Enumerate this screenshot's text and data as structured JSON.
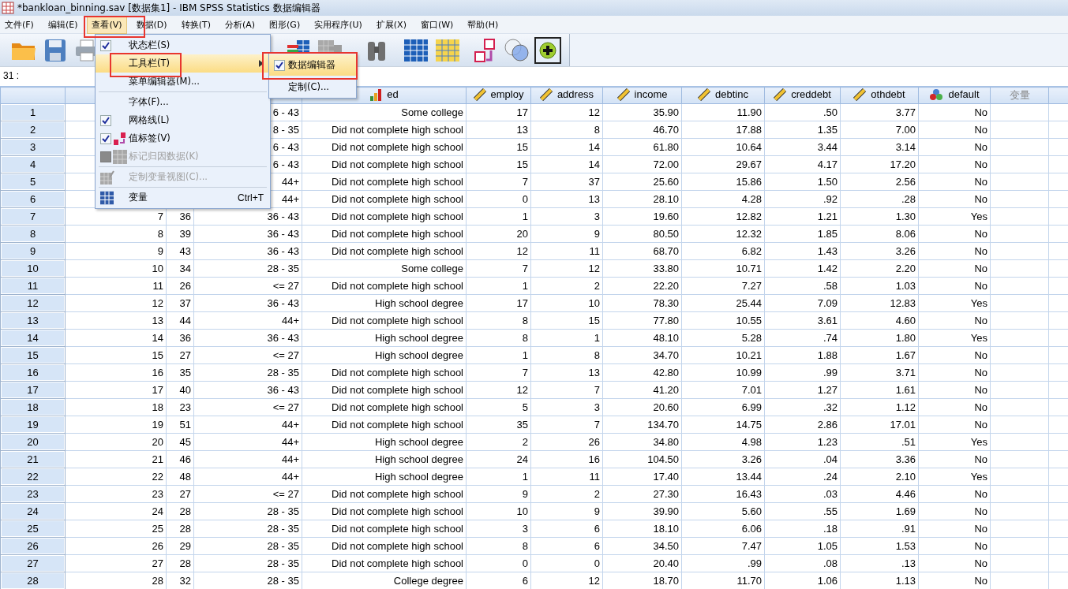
{
  "window": {
    "title": "*bankloan_binning.sav [数据集1] - IBM SPSS Statistics 数据编辑器"
  },
  "menu_bar": [
    {
      "label": "文件(F)",
      "selected": false
    },
    {
      "label": "编辑(E)",
      "selected": false
    },
    {
      "label": "查看(V)",
      "selected": true
    },
    {
      "label": "数据(D)",
      "selected": false
    },
    {
      "label": "转换(T)",
      "selected": false
    },
    {
      "label": "分析(A)",
      "selected": false
    },
    {
      "label": "图形(G)",
      "selected": false
    },
    {
      "label": "实用程序(U)",
      "selected": false
    },
    {
      "label": "扩展(X)",
      "selected": false
    },
    {
      "label": "窗口(W)",
      "selected": false
    },
    {
      "label": "帮助(H)",
      "selected": false
    }
  ],
  "view_menu": [
    {
      "kind": "check",
      "label": "状态栏(S)",
      "checked": true,
      "disabled": false,
      "highlighted": false
    },
    {
      "kind": "submenu",
      "label": "工具栏(T)",
      "disabled": false,
      "highlighted": true
    },
    {
      "kind": "plain",
      "label": "菜单编辑器(M)...",
      "disabled": false,
      "highlighted": false
    },
    {
      "kind": "separator"
    },
    {
      "kind": "plain",
      "label": "字体(F)...",
      "disabled": false,
      "highlighted": false
    },
    {
      "kind": "check",
      "label": "网格线(L)",
      "checked": true,
      "disabled": false,
      "highlighted": false
    },
    {
      "kind": "labels",
      "label": "值标签(V)",
      "checked": true,
      "disabled": false,
      "highlighted": false
    },
    {
      "kind": "impute",
      "label": "标记归因数据(K)",
      "disabled": true,
      "highlighted": false
    },
    {
      "kind": "separator"
    },
    {
      "kind": "view",
      "label": "定制变量视图(C)...",
      "disabled": true,
      "highlighted": false
    },
    {
      "kind": "separator"
    },
    {
      "kind": "variables",
      "label": "变量",
      "shortcut": "Ctrl+T",
      "disabled": false,
      "highlighted": false
    }
  ],
  "toolbar_submenu": [
    {
      "kind": "check",
      "label": "数据编辑器",
      "checked": true,
      "highlighted": true
    },
    {
      "kind": "plain",
      "label": "定制(C)...",
      "highlighted": false
    }
  ],
  "cell_editor": {
    "label": "31 :"
  },
  "table": {
    "columns": [
      {
        "kind": "hidden"
      },
      {
        "kind": "hidden"
      },
      {
        "kind": "hidden"
      },
      {
        "kind": "ordinal",
        "label": "ed"
      },
      {
        "kind": "scale",
        "label": "employ"
      },
      {
        "kind": "scale",
        "label": "address"
      },
      {
        "kind": "scale",
        "label": "income"
      },
      {
        "kind": "scale",
        "label": "debtinc"
      },
      {
        "kind": "scale",
        "label": "creddebt"
      },
      {
        "kind": "scale",
        "label": "othdebt"
      },
      {
        "kind": "nominal",
        "label": "default"
      },
      {
        "kind": "empty",
        "label": "变量"
      },
      {
        "kind": "hidden"
      }
    ],
    "rows": [
      {
        "number": "1",
        "cells": [
          null,
          null,
          "6 - 43",
          "Some college",
          "17",
          "12",
          "35.90",
          "11.90",
          ".50",
          "3.77",
          "No"
        ]
      },
      {
        "number": "2",
        "cells": [
          null,
          null,
          "8 - 35",
          "Did not complete high school",
          "13",
          "8",
          "46.70",
          "17.88",
          "1.35",
          "7.00",
          "No"
        ]
      },
      {
        "number": "3",
        "cells": [
          null,
          null,
          "6 - 43",
          "Did not complete high school",
          "15",
          "14",
          "61.80",
          "10.64",
          "3.44",
          "3.14",
          "No"
        ]
      },
      {
        "number": "4",
        "cells": [
          null,
          null,
          "6 - 43",
          "Did not complete high school",
          "15",
          "14",
          "72.00",
          "29.67",
          "4.17",
          "17.20",
          "No"
        ]
      },
      {
        "number": "5",
        "cells": [
          null,
          null,
          "44+",
          "Did not complete high school",
          "7",
          "37",
          "25.60",
          "15.86",
          "1.50",
          "2.56",
          "No"
        ]
      },
      {
        "number": "6",
        "cells": [
          null,
          null,
          "44+",
          "Did not complete high school",
          "0",
          "13",
          "28.10",
          "4.28",
          ".92",
          ".28",
          "No"
        ]
      },
      {
        "number": "7",
        "cells": [
          "7",
          "36",
          "36 - 43",
          "Did not complete high school",
          "1",
          "3",
          "19.60",
          "12.82",
          "1.21",
          "1.30",
          "Yes"
        ]
      },
      {
        "number": "8",
        "cells": [
          "8",
          "39",
          "36 - 43",
          "Did not complete high school",
          "20",
          "9",
          "80.50",
          "12.32",
          "1.85",
          "8.06",
          "No"
        ]
      },
      {
        "number": "9",
        "cells": [
          "9",
          "43",
          "36 - 43",
          "Did not complete high school",
          "12",
          "11",
          "68.70",
          "6.82",
          "1.43",
          "3.26",
          "No"
        ]
      },
      {
        "number": "10",
        "cells": [
          "10",
          "34",
          "28 - 35",
          "Some college",
          "7",
          "12",
          "33.80",
          "10.71",
          "1.42",
          "2.20",
          "No"
        ]
      },
      {
        "number": "11",
        "cells": [
          "11",
          "26",
          "<= 27",
          "Did not complete high school",
          "1",
          "2",
          "22.20",
          "7.27",
          ".58",
          "1.03",
          "No"
        ]
      },
      {
        "number": "12",
        "cells": [
          "12",
          "37",
          "36 - 43",
          "High school degree",
          "17",
          "10",
          "78.30",
          "25.44",
          "7.09",
          "12.83",
          "Yes"
        ]
      },
      {
        "number": "13",
        "cells": [
          "13",
          "44",
          "44+",
          "Did not complete high school",
          "8",
          "15",
          "77.80",
          "10.55",
          "3.61",
          "4.60",
          "No"
        ]
      },
      {
        "number": "14",
        "cells": [
          "14",
          "36",
          "36 - 43",
          "High school degree",
          "8",
          "1",
          "48.10",
          "5.28",
          ".74",
          "1.80",
          "Yes"
        ]
      },
      {
        "number": "15",
        "cells": [
          "15",
          "27",
          "<= 27",
          "High school degree",
          "1",
          "8",
          "34.70",
          "10.21",
          "1.88",
          "1.67",
          "No"
        ]
      },
      {
        "number": "16",
        "cells": [
          "16",
          "35",
          "28 - 35",
          "Did not complete high school",
          "7",
          "13",
          "42.80",
          "10.99",
          ".99",
          "3.71",
          "No"
        ]
      },
      {
        "number": "17",
        "cells": [
          "17",
          "40",
          "36 - 43",
          "Did not complete high school",
          "12",
          "7",
          "41.20",
          "7.01",
          "1.27",
          "1.61",
          "No"
        ]
      },
      {
        "number": "18",
        "cells": [
          "18",
          "23",
          "<= 27",
          "Did not complete high school",
          "5",
          "3",
          "20.60",
          "6.99",
          ".32",
          "1.12",
          "No"
        ]
      },
      {
        "number": "19",
        "cells": [
          "19",
          "51",
          "44+",
          "Did not complete high school",
          "35",
          "7",
          "134.70",
          "14.75",
          "2.86",
          "17.01",
          "No"
        ]
      },
      {
        "number": "20",
        "cells": [
          "20",
          "45",
          "44+",
          "High school degree",
          "2",
          "26",
          "34.80",
          "4.98",
          "1.23",
          ".51",
          "Yes"
        ]
      },
      {
        "number": "21",
        "cells": [
          "21",
          "46",
          "44+",
          "High school degree",
          "24",
          "16",
          "104.50",
          "3.26",
          ".04",
          "3.36",
          "No"
        ]
      },
      {
        "number": "22",
        "cells": [
          "22",
          "48",
          "44+",
          "High school degree",
          "1",
          "11",
          "17.40",
          "13.44",
          ".24",
          "2.10",
          "Yes"
        ]
      },
      {
        "number": "23",
        "cells": [
          "23",
          "27",
          "<= 27",
          "Did not complete high school",
          "9",
          "2",
          "27.30",
          "16.43",
          ".03",
          "4.46",
          "No"
        ]
      },
      {
        "number": "24",
        "cells": [
          "24",
          "28",
          "28 - 35",
          "Did not complete high school",
          "10",
          "9",
          "39.90",
          "5.60",
          ".55",
          "1.69",
          "No"
        ]
      },
      {
        "number": "25",
        "cells": [
          "25",
          "28",
          "28 - 35",
          "Did not complete high school",
          "3",
          "6",
          "18.10",
          "6.06",
          ".18",
          ".91",
          "No"
        ]
      },
      {
        "number": "26",
        "cells": [
          "26",
          "29",
          "28 - 35",
          "Did not complete high school",
          "8",
          "6",
          "34.50",
          "7.47",
          "1.05",
          "1.53",
          "No"
        ]
      },
      {
        "number": "27",
        "cells": [
          "27",
          "28",
          "28 - 35",
          "Did not complete high school",
          "0",
          "0",
          "20.40",
          ".99",
          ".08",
          ".13",
          "No"
        ]
      },
      {
        "number": "28",
        "cells": [
          "28",
          "32",
          "28 - 35",
          "College degree",
          "6",
          "12",
          "18.70",
          "11.70",
          "1.06",
          "1.13",
          "No"
        ]
      }
    ]
  }
}
